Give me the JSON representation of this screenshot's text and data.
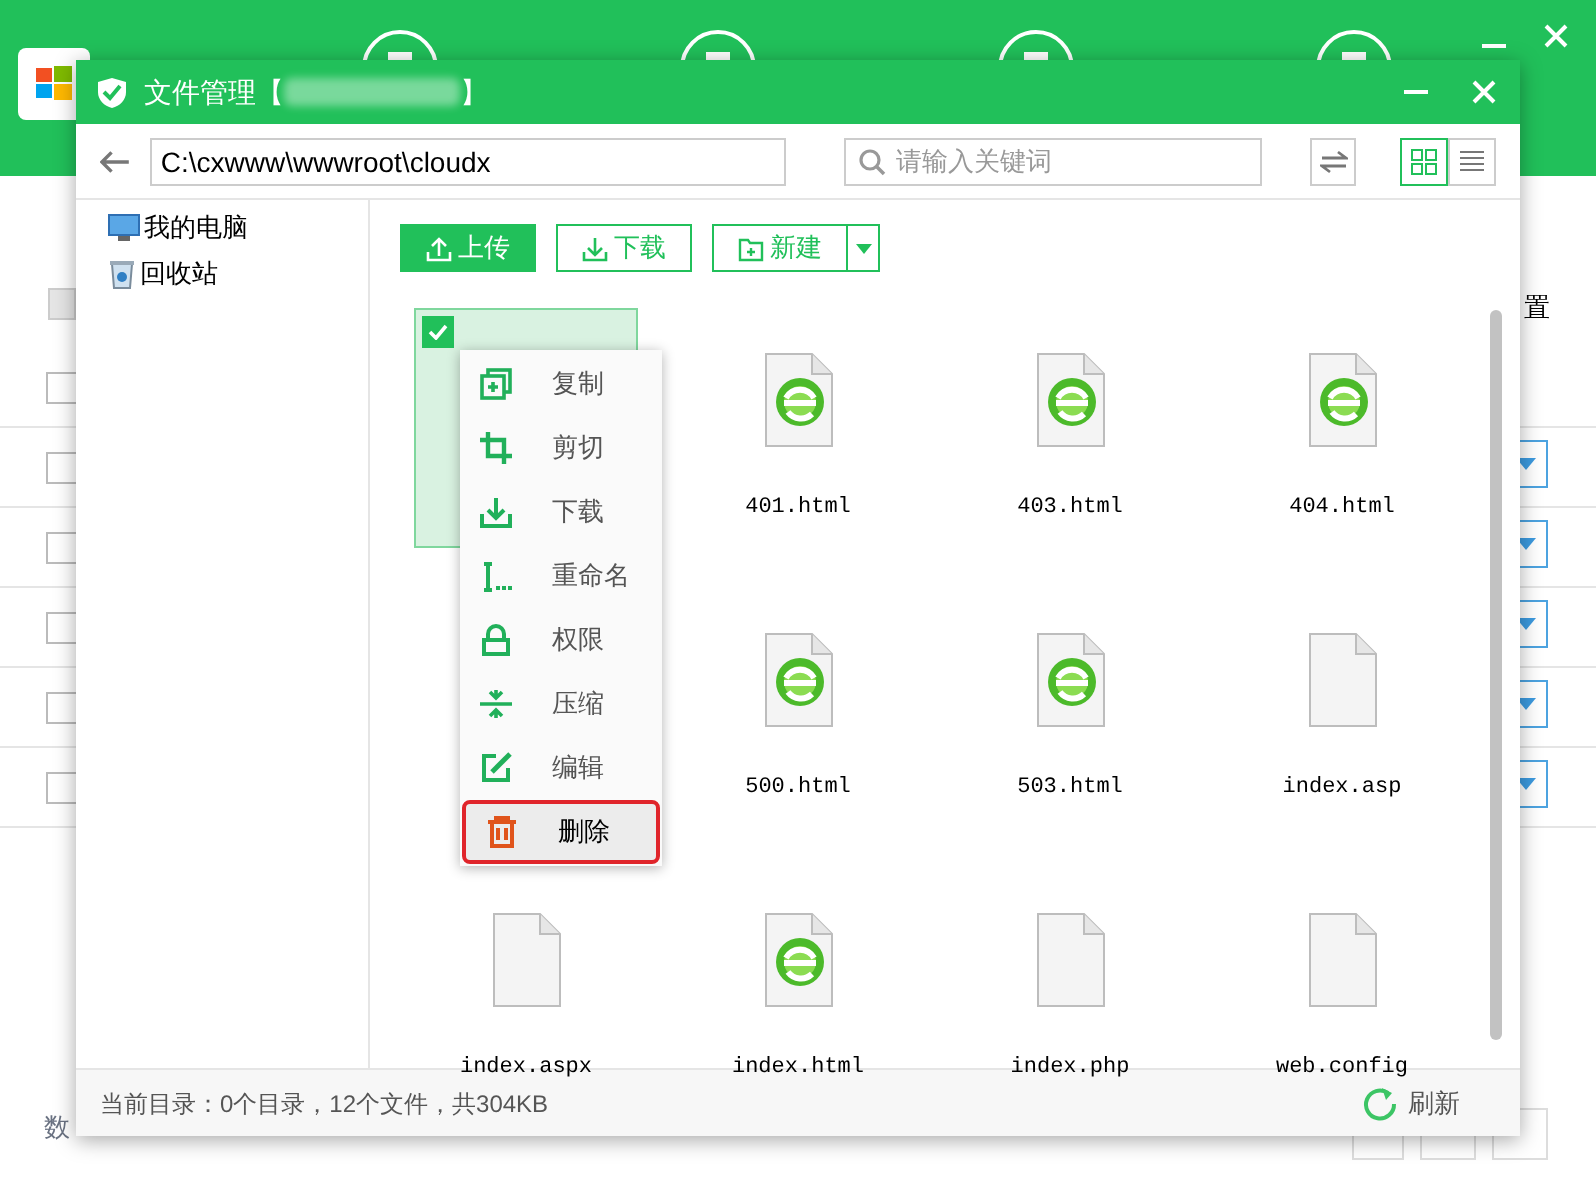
{
  "background_app": {
    "column_header_tail": "置",
    "footer_text": "数",
    "rows": [
      {
        "checked": false
      },
      {
        "checked": false
      },
      {
        "checked": false
      },
      {
        "checked": false
      },
      {
        "checked": false
      },
      {
        "checked": false
      }
    ]
  },
  "window": {
    "title_prefix": "文件管理【",
    "title_suffix": "】"
  },
  "toolbar": {
    "path": "C:\\cxwww\\wwwroot\\cloudx",
    "search": {
      "placeholder": "请输入关键词"
    },
    "views": [
      {
        "kind": "grid",
        "selected": true
      },
      {
        "kind": "list",
        "selected": false
      }
    ]
  },
  "sidebar": {
    "items": [
      {
        "kind": "computer",
        "label": "我的电脑"
      },
      {
        "kind": "recycle",
        "label": "回收站"
      }
    ]
  },
  "actions": [
    {
      "kind": "upload",
      "label": "上传",
      "primary": true
    },
    {
      "kind": "download",
      "label": "下载",
      "primary": false
    },
    {
      "kind": "new",
      "label": "新建",
      "primary": false,
      "dropdown": true
    }
  ],
  "files": [
    {
      "kind": "hidden",
      "selected": true
    },
    {
      "kind": "html",
      "name": "401.html",
      "selected": false
    },
    {
      "kind": "html",
      "name": "403.html",
      "selected": false
    },
    {
      "kind": "html",
      "name": "404.html",
      "selected": false
    },
    {
      "kind": "hidden"
    },
    {
      "kind": "html",
      "name": "500.html",
      "selected": false
    },
    {
      "kind": "html",
      "name": "503.html",
      "selected": false
    },
    {
      "kind": "blank",
      "name": "index.asp",
      "selected": false
    },
    {
      "kind": "blank",
      "name": "index.aspx",
      "selected": false
    },
    {
      "kind": "html",
      "name": "index.html",
      "selected": false
    },
    {
      "kind": "blank",
      "name": "index.php",
      "selected": false
    },
    {
      "kind": "blank",
      "name": "web.config",
      "selected": false
    }
  ],
  "context_menu": [
    {
      "kind": "copy",
      "label": "复制",
      "highlighted": false
    },
    {
      "kind": "cut",
      "label": "剪切",
      "highlighted": false
    },
    {
      "kind": "download",
      "label": "下载",
      "highlighted": false
    },
    {
      "kind": "rename",
      "label": "重命名",
      "highlighted": false
    },
    {
      "kind": "lock",
      "label": "权限",
      "highlighted": false
    },
    {
      "kind": "compress",
      "label": "压缩",
      "highlighted": false
    },
    {
      "kind": "edit",
      "label": "编辑",
      "highlighted": false
    },
    {
      "kind": "delete",
      "label": "删除",
      "highlighted": true
    }
  ],
  "status_bar": {
    "summary": "当前目录：0个目录，12个文件，共304KB",
    "refresh": "刷新"
  }
}
